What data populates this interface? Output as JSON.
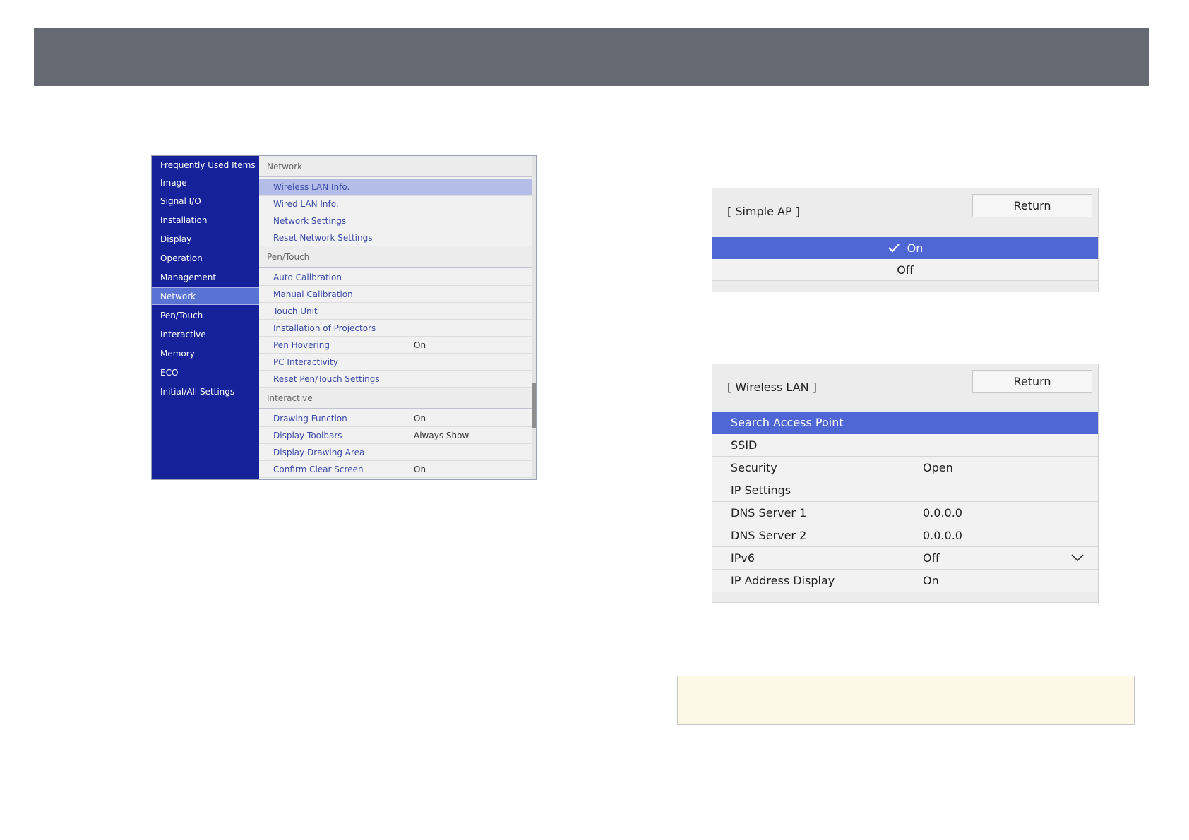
{
  "left_menu": {
    "sidebar": [
      "Frequently Used Items",
      "Image",
      "Signal I/O",
      "Installation",
      "Display",
      "Operation",
      "Management",
      "Network",
      "Pen/Touch",
      "Interactive",
      "Memory",
      "ECO",
      "Initial/All Settings"
    ],
    "selected_sidebar": "Network",
    "sections": {
      "network": {
        "header": "Network",
        "items": [
          "Wireless LAN Info.",
          "Wired LAN Info.",
          "Network Settings",
          "Reset Network Settings"
        ]
      },
      "pen_touch": {
        "header": "Pen/Touch",
        "items": [
          "Auto Calibration",
          "Manual Calibration",
          "Touch Unit",
          "Installation of Projectors",
          "Pen Hovering",
          "PC Interactivity",
          "Reset Pen/Touch Settings"
        ],
        "pen_hovering_value": "On"
      },
      "interactive": {
        "header": "Interactive",
        "items": [
          "Drawing Function",
          "Display Toolbars",
          "Display Drawing Area",
          "Confirm Clear Screen"
        ],
        "drawing_function_value": "On",
        "display_toolbars_value": "Always Show",
        "confirm_clear_screen_value": "On"
      }
    }
  },
  "simple_ap_dialog": {
    "title": "[ Simple AP ]",
    "return_label": "Return",
    "options": [
      "On",
      "Off"
    ],
    "selected": "On"
  },
  "wireless_lan_dialog": {
    "title": "[ Wireless LAN ]",
    "return_label": "Return",
    "rows": [
      {
        "label": "Search Access Point",
        "value": ""
      },
      {
        "label": "SSID",
        "value": ""
      },
      {
        "label": "Security",
        "value": "Open"
      },
      {
        "label": "IP Settings",
        "value": ""
      },
      {
        "label": "DNS Server 1",
        "value": "0.0.0.0"
      },
      {
        "label": "DNS Server 2",
        "value": "0.0.0.0"
      },
      {
        "label": "IPv6",
        "value": "Off"
      },
      {
        "label": "IP Address Display",
        "value": "On"
      }
    ]
  },
  "colors": {
    "top_bar": "#666971",
    "sidebar_bg": "#15229a",
    "sidebar_selected": "#5973d4",
    "dialog_selected": "#4e67d4",
    "note_bg": "#fdf8e7"
  }
}
